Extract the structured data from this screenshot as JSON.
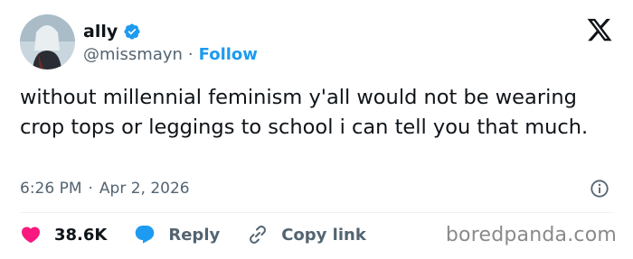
{
  "author": {
    "name": "ally",
    "handle": "@missmayn",
    "separator": "·",
    "follow_label": "Follow",
    "verified": true
  },
  "tweet": {
    "text": "without millennial feminism y'all would not be wearing crop tops or leggings to school i can tell you that much.",
    "time": "6:26 PM",
    "date": "Apr 2, 2026"
  },
  "actions": {
    "likes": "38.6K",
    "reply_label": "Reply",
    "copy_label": "Copy link"
  },
  "watermark": "boredpanda.com",
  "colors": {
    "accent": "#1d9bf0",
    "like": "#f91880",
    "text": "#0f1419",
    "muted": "#536471"
  },
  "icons": [
    "x-logo",
    "verified-badge",
    "info-icon",
    "heart-icon",
    "reply-bubble-icon",
    "link-icon"
  ]
}
